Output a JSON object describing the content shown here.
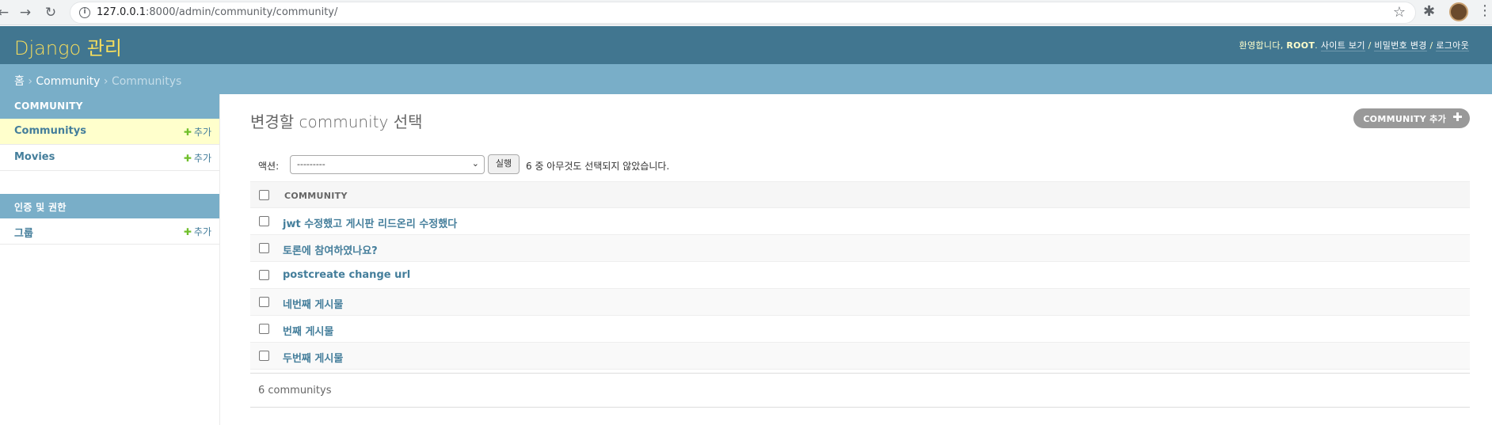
{
  "browser": {
    "url_host": "127.0.0.1",
    "url_port_path": ":8000/admin/community/community/"
  },
  "header": {
    "branding": "Django 관리",
    "welcome": "환영합니다,",
    "username": "ROOT",
    "view_site": "사이트 보기",
    "change_password": "비밀번호 변경",
    "logout": "로그아웃",
    "sep": "/"
  },
  "breadcrumbs": {
    "home": "홈",
    "app": "Community",
    "current": "Communitys",
    "sep": "›"
  },
  "sidebar": {
    "modules": [
      {
        "caption": "COMMUNITY",
        "items": [
          {
            "name": "Communitys",
            "add": "추가",
            "current": true
          },
          {
            "name": "Movies",
            "add": "추가",
            "current": false
          }
        ]
      },
      {
        "caption": "인증 및 권한",
        "items": [
          {
            "name": "그룹",
            "add": "추가",
            "current": false
          }
        ]
      }
    ]
  },
  "content": {
    "title": "변경할 community 선택",
    "add_button": "COMMUNITY 추가",
    "actions": {
      "label": "액션:",
      "selected": "---------",
      "go": "실행",
      "counter": "6 중 아무것도 선택되지 않았습니다."
    },
    "table": {
      "column": "COMMUNITY",
      "rows": [
        "jwt 수정했고 게시판 리드온리 수정했다",
        "토론에 참여하였나요?",
        "postcreate change url",
        "네번째 게시물",
        "번째 게시물",
        "두번째 게시물"
      ]
    },
    "paginator": "6 communitys"
  },
  "colors": {
    "header": "#417690",
    "breadcrumbs": "#79aec8",
    "branding": "#f5dd5d",
    "link": "#447e9b",
    "add_plus": "#70bf2b",
    "current_row": "#ffffcc"
  }
}
